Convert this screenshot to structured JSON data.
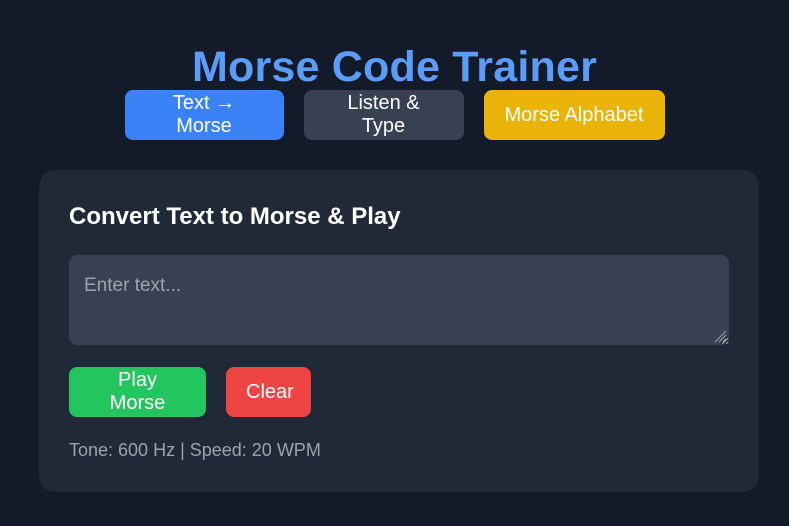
{
  "app": {
    "title": "Morse Code Trainer"
  },
  "modes": [
    {
      "label": "Text → Morse",
      "color": "#3b82f6",
      "active": true
    },
    {
      "label": "Listen & Type",
      "color": "#374151",
      "active": false
    },
    {
      "label": "Morse Alphabet",
      "color": "#eab308",
      "active": false
    }
  ],
  "panel": {
    "title": "Convert Text to Morse & Play",
    "input": {
      "value": "",
      "placeholder": "Enter text..."
    },
    "buttons": {
      "play_label": "Play Morse",
      "clear_label": "Clear"
    },
    "status": "Tone: 600 Hz | Speed: 20 WPM"
  },
  "colors": {
    "background": "#131a2a",
    "card": "#1f2937",
    "title": "#5b9cf6",
    "play": "#22c55e",
    "clear": "#ef4444"
  }
}
